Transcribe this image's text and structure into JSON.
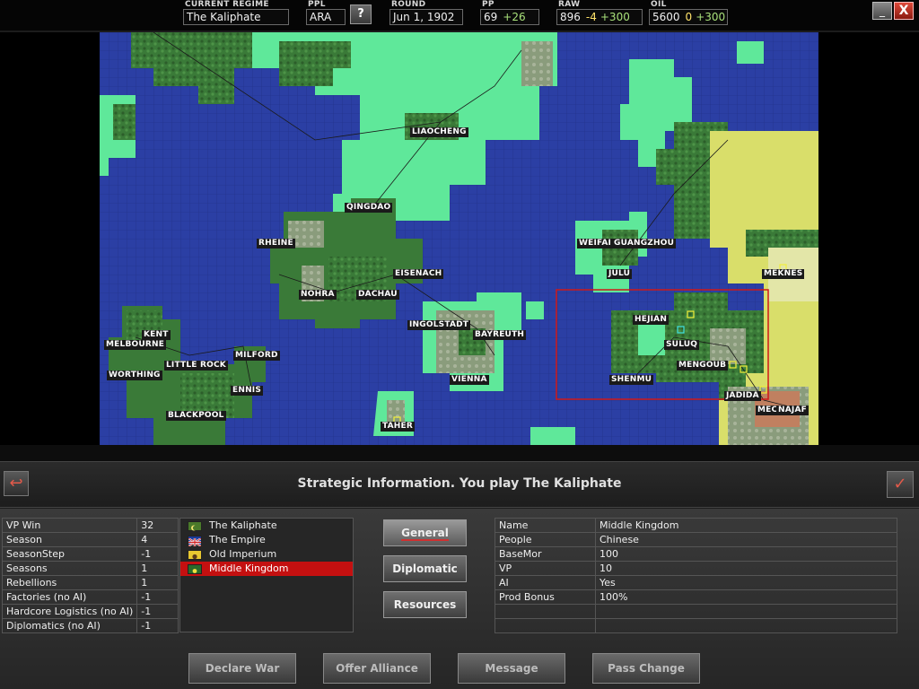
{
  "topbar": {
    "regime_label": "CURRENT REGIME",
    "regime": "The Kaliphate",
    "ppl_label": "PPL",
    "ppl": "ARA",
    "help": "?",
    "round_label": "ROUND",
    "round": "Jun 1, 1902",
    "pp_label": "PP",
    "pp": "69",
    "pp_delta": "+26",
    "raw_label": "RAW",
    "raw": "896",
    "raw_neg": "-4",
    "raw_delta": "+300",
    "oil_label": "OIL",
    "oil": "5600",
    "oil_neg": "0",
    "oil_delta": "+300",
    "minimize": "_",
    "close": "X"
  },
  "map": {
    "cities": [
      {
        "name": "LIAOCHENG"
      },
      {
        "name": "QINGDAO"
      },
      {
        "name": "RHEINE"
      },
      {
        "name": "EISENACH"
      },
      {
        "name": "NOHRA"
      },
      {
        "name": "DACHAU"
      },
      {
        "name": "INGOLSTADT"
      },
      {
        "name": "BAYREUTH"
      },
      {
        "name": "VIENNA"
      },
      {
        "name": "TAHER"
      },
      {
        "name": "KENT"
      },
      {
        "name": "MELBOURNE"
      },
      {
        "name": "MILFORD"
      },
      {
        "name": "LITTLE ROCK"
      },
      {
        "name": "WORTHING"
      },
      {
        "name": "ENNIS"
      },
      {
        "name": "BLACKPOOL"
      },
      {
        "name": "WEIFAI"
      },
      {
        "name": "GUANGZHOU"
      },
      {
        "name": "JULU"
      },
      {
        "name": "MEKNES"
      },
      {
        "name": "HEJIAN"
      },
      {
        "name": "SULUQ"
      },
      {
        "name": "MENGOUB"
      },
      {
        "name": "SHENMU"
      },
      {
        "name": "JADIDA"
      },
      {
        "name": "MEC"
      },
      {
        "name": "NAJAF"
      }
    ],
    "colors": {
      "sea": "#2b3fa4",
      "land_green": "#5fe89a",
      "land_yellow": "#d9de6a",
      "forest": "#3f7a3a",
      "selection": "#d01818"
    }
  },
  "message": {
    "back": "↩",
    "text": "Strategic Information. You play The Kaliphate",
    "ok": "✓"
  },
  "vp_table": [
    {
      "k": "VP Win",
      "v": "32"
    },
    {
      "k": "Season",
      "v": "4"
    },
    {
      "k": "SeasonStep",
      "v": "-1"
    },
    {
      "k": "Seasons",
      "v": "1"
    },
    {
      "k": "Rebellions",
      "v": "1"
    },
    {
      "k": "Factories (no AI)",
      "v": "-1"
    },
    {
      "k": "Hardcore Logistics (no AI)",
      "v": "-1"
    },
    {
      "k": "Diplomatics (no AI)",
      "v": "-1"
    }
  ],
  "regimes": [
    {
      "name": "The Kaliphate",
      "flag": "kaliphate-flag"
    },
    {
      "name": "The Empire",
      "flag": "empire-flag"
    },
    {
      "name": "Old Imperium",
      "flag": "imperium-flag"
    },
    {
      "name": "Middle Kingdom",
      "flag": "middle-kingdom-flag",
      "selected": true
    }
  ],
  "tabs": {
    "general": "General",
    "diplomatic": "Diplomatic",
    "resources": "Resources"
  },
  "info_table": [
    {
      "k": "Name",
      "v": "Middle Kingdom"
    },
    {
      "k": "People",
      "v": "Chinese"
    },
    {
      "k": "BaseMor",
      "v": "100"
    },
    {
      "k": "VP",
      "v": "10"
    },
    {
      "k": "AI",
      "v": "Yes"
    },
    {
      "k": "Prod Bonus",
      "v": "100%"
    }
  ],
  "actions": {
    "declare_war": "Declare War",
    "offer_alliance": "Offer Alliance",
    "message": "Message",
    "pass_change": "Pass Change"
  }
}
